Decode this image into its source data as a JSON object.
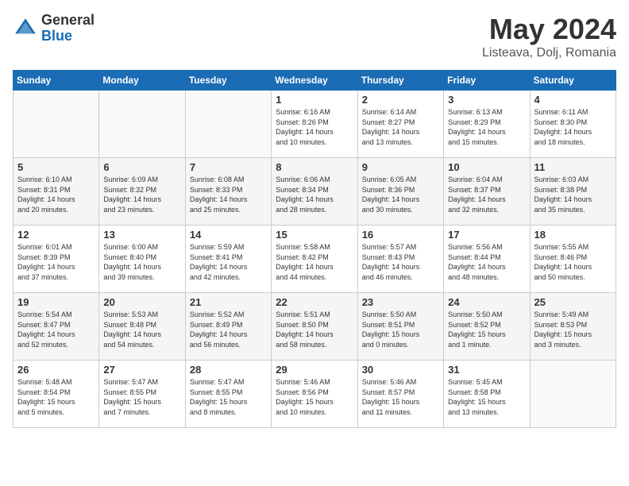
{
  "header": {
    "logo_general": "General",
    "logo_blue": "Blue",
    "month_title": "May 2024",
    "location": "Listeava, Dolj, Romania"
  },
  "days_of_week": [
    "Sunday",
    "Monday",
    "Tuesday",
    "Wednesday",
    "Thursday",
    "Friday",
    "Saturday"
  ],
  "weeks": [
    [
      {
        "day": "",
        "content": ""
      },
      {
        "day": "",
        "content": ""
      },
      {
        "day": "",
        "content": ""
      },
      {
        "day": "1",
        "content": "Sunrise: 6:16 AM\nSunset: 8:26 PM\nDaylight: 14 hours\nand 10 minutes."
      },
      {
        "day": "2",
        "content": "Sunrise: 6:14 AM\nSunset: 8:27 PM\nDaylight: 14 hours\nand 13 minutes."
      },
      {
        "day": "3",
        "content": "Sunrise: 6:13 AM\nSunset: 8:29 PM\nDaylight: 14 hours\nand 15 minutes."
      },
      {
        "day": "4",
        "content": "Sunrise: 6:11 AM\nSunset: 8:30 PM\nDaylight: 14 hours\nand 18 minutes."
      }
    ],
    [
      {
        "day": "5",
        "content": "Sunrise: 6:10 AM\nSunset: 8:31 PM\nDaylight: 14 hours\nand 20 minutes."
      },
      {
        "day": "6",
        "content": "Sunrise: 6:09 AM\nSunset: 8:32 PM\nDaylight: 14 hours\nand 23 minutes."
      },
      {
        "day": "7",
        "content": "Sunrise: 6:08 AM\nSunset: 8:33 PM\nDaylight: 14 hours\nand 25 minutes."
      },
      {
        "day": "8",
        "content": "Sunrise: 6:06 AM\nSunset: 8:34 PM\nDaylight: 14 hours\nand 28 minutes."
      },
      {
        "day": "9",
        "content": "Sunrise: 6:05 AM\nSunset: 8:36 PM\nDaylight: 14 hours\nand 30 minutes."
      },
      {
        "day": "10",
        "content": "Sunrise: 6:04 AM\nSunset: 8:37 PM\nDaylight: 14 hours\nand 32 minutes."
      },
      {
        "day": "11",
        "content": "Sunrise: 6:03 AM\nSunset: 8:38 PM\nDaylight: 14 hours\nand 35 minutes."
      }
    ],
    [
      {
        "day": "12",
        "content": "Sunrise: 6:01 AM\nSunset: 8:39 PM\nDaylight: 14 hours\nand 37 minutes."
      },
      {
        "day": "13",
        "content": "Sunrise: 6:00 AM\nSunset: 8:40 PM\nDaylight: 14 hours\nand 39 minutes."
      },
      {
        "day": "14",
        "content": "Sunrise: 5:59 AM\nSunset: 8:41 PM\nDaylight: 14 hours\nand 42 minutes."
      },
      {
        "day": "15",
        "content": "Sunrise: 5:58 AM\nSunset: 8:42 PM\nDaylight: 14 hours\nand 44 minutes."
      },
      {
        "day": "16",
        "content": "Sunrise: 5:57 AM\nSunset: 8:43 PM\nDaylight: 14 hours\nand 46 minutes."
      },
      {
        "day": "17",
        "content": "Sunrise: 5:56 AM\nSunset: 8:44 PM\nDaylight: 14 hours\nand 48 minutes."
      },
      {
        "day": "18",
        "content": "Sunrise: 5:55 AM\nSunset: 8:46 PM\nDaylight: 14 hours\nand 50 minutes."
      }
    ],
    [
      {
        "day": "19",
        "content": "Sunrise: 5:54 AM\nSunset: 8:47 PM\nDaylight: 14 hours\nand 52 minutes."
      },
      {
        "day": "20",
        "content": "Sunrise: 5:53 AM\nSunset: 8:48 PM\nDaylight: 14 hours\nand 54 minutes."
      },
      {
        "day": "21",
        "content": "Sunrise: 5:52 AM\nSunset: 8:49 PM\nDaylight: 14 hours\nand 56 minutes."
      },
      {
        "day": "22",
        "content": "Sunrise: 5:51 AM\nSunset: 8:50 PM\nDaylight: 14 hours\nand 58 minutes."
      },
      {
        "day": "23",
        "content": "Sunrise: 5:50 AM\nSunset: 8:51 PM\nDaylight: 15 hours\nand 0 minutes."
      },
      {
        "day": "24",
        "content": "Sunrise: 5:50 AM\nSunset: 8:52 PM\nDaylight: 15 hours\nand 1 minute."
      },
      {
        "day": "25",
        "content": "Sunrise: 5:49 AM\nSunset: 8:53 PM\nDaylight: 15 hours\nand 3 minutes."
      }
    ],
    [
      {
        "day": "26",
        "content": "Sunrise: 5:48 AM\nSunset: 8:54 PM\nDaylight: 15 hours\nand 5 minutes."
      },
      {
        "day": "27",
        "content": "Sunrise: 5:47 AM\nSunset: 8:55 PM\nDaylight: 15 hours\nand 7 minutes."
      },
      {
        "day": "28",
        "content": "Sunrise: 5:47 AM\nSunset: 8:55 PM\nDaylight: 15 hours\nand 8 minutes."
      },
      {
        "day": "29",
        "content": "Sunrise: 5:46 AM\nSunset: 8:56 PM\nDaylight: 15 hours\nand 10 minutes."
      },
      {
        "day": "30",
        "content": "Sunrise: 5:46 AM\nSunset: 8:57 PM\nDaylight: 15 hours\nand 11 minutes."
      },
      {
        "day": "31",
        "content": "Sunrise: 5:45 AM\nSunset: 8:58 PM\nDaylight: 15 hours\nand 13 minutes."
      },
      {
        "day": "",
        "content": ""
      }
    ]
  ]
}
